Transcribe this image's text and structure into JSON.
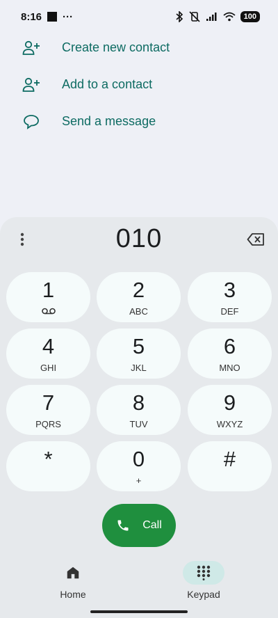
{
  "status_bar": {
    "time": "8:16",
    "dots": "···",
    "battery": "100"
  },
  "actions": [
    {
      "label": "Create new contact",
      "icon": "person-add-icon"
    },
    {
      "label": "Add to a contact",
      "icon": "person-add-icon"
    },
    {
      "label": "Send a message",
      "icon": "message-icon"
    }
  ],
  "dialpad": {
    "digits": "010",
    "keys": [
      {
        "num": "1",
        "sub": ""
      },
      {
        "num": "2",
        "sub": "ABC"
      },
      {
        "num": "3",
        "sub": "DEF"
      },
      {
        "num": "4",
        "sub": "GHI"
      },
      {
        "num": "5",
        "sub": "JKL"
      },
      {
        "num": "6",
        "sub": "MNO"
      },
      {
        "num": "7",
        "sub": "PQRS"
      },
      {
        "num": "8",
        "sub": "TUV"
      },
      {
        "num": "9",
        "sub": "WXYZ"
      },
      {
        "num": "*",
        "sub": ""
      },
      {
        "num": "0",
        "sub": "+"
      },
      {
        "num": "#",
        "sub": ""
      }
    ],
    "call_label": "Call"
  },
  "nav": {
    "home_label": "Home",
    "keypad_label": "Keypad"
  },
  "colors": {
    "accent": "#0d6b62",
    "call": "#1f8f3e",
    "active_nav": "#cfe9e7"
  }
}
